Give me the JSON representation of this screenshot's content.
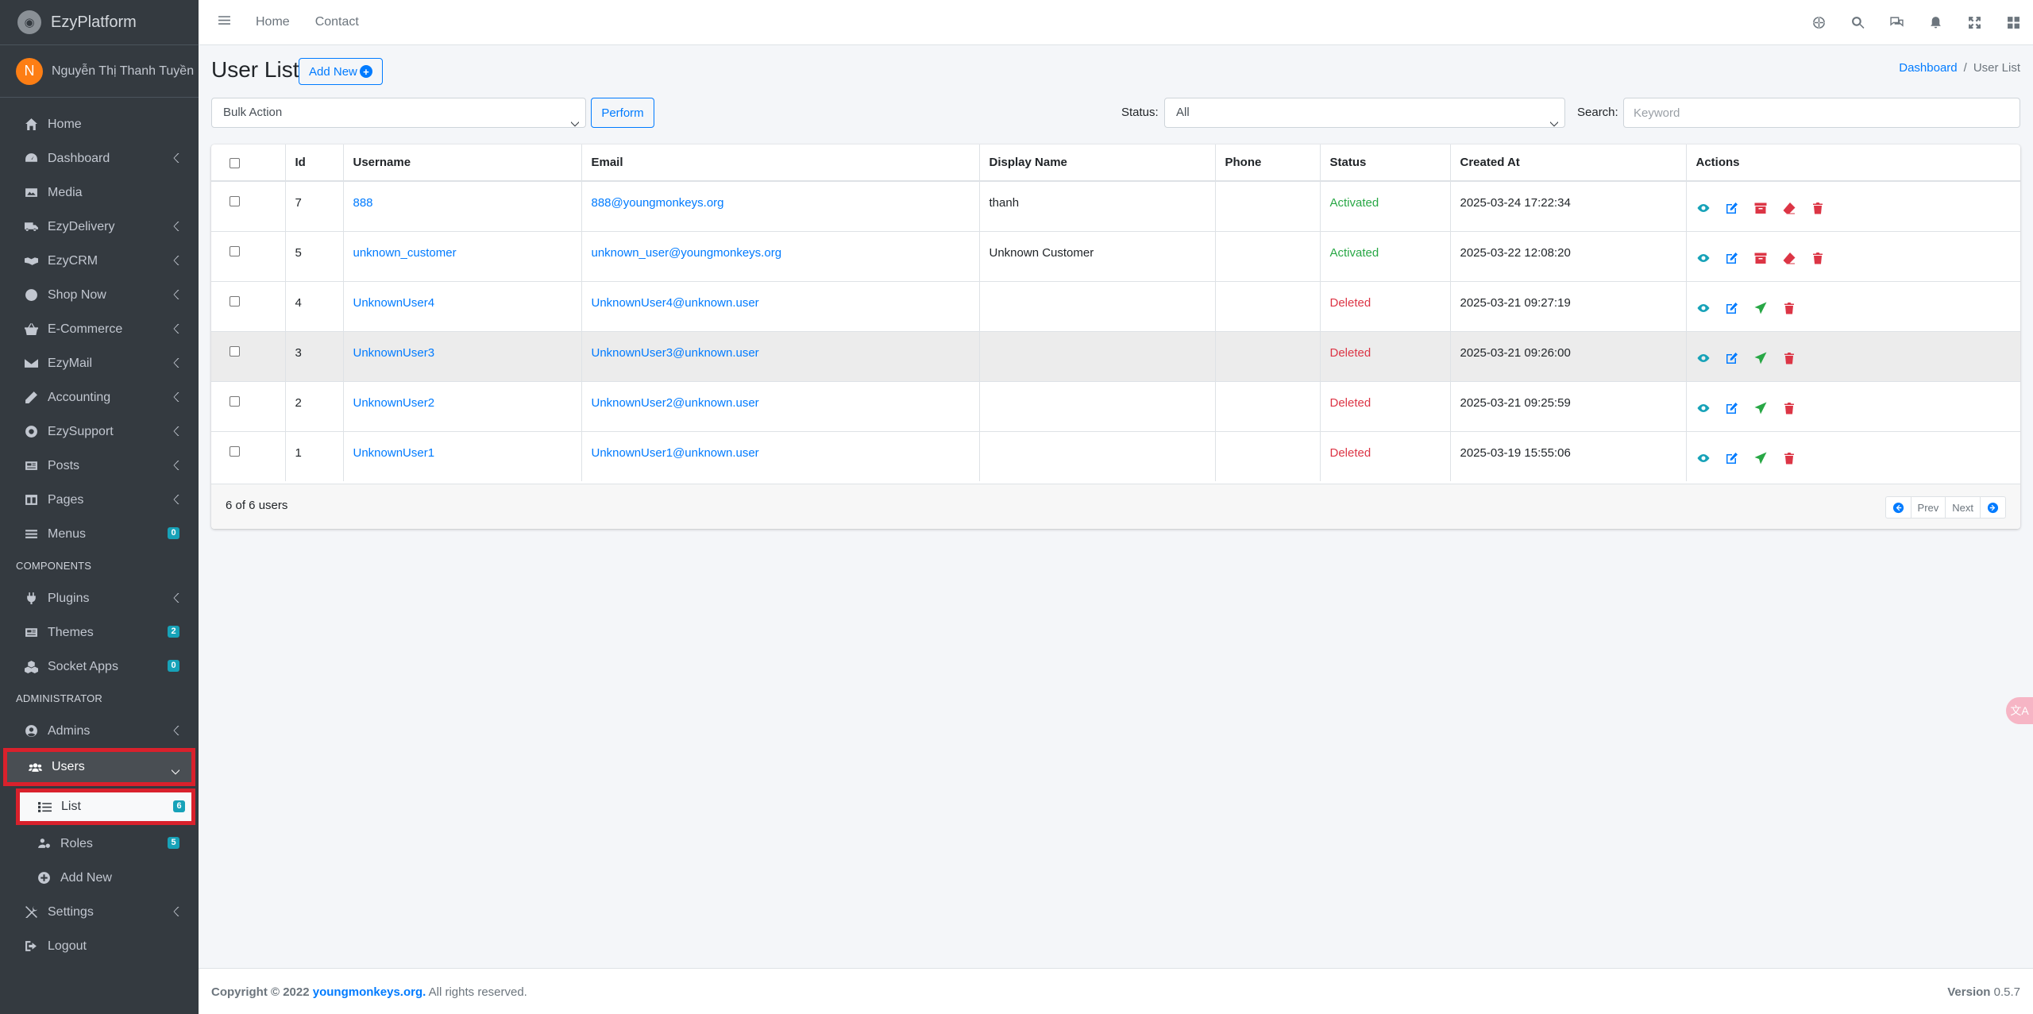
{
  "brand": {
    "name": "EzyPlatform"
  },
  "user": {
    "initial": "N",
    "name": "Nguyễn Thị Thanh Tuyền"
  },
  "sidebar": {
    "items": [
      {
        "label": "Home"
      },
      {
        "label": "Dashboard"
      },
      {
        "label": "Media"
      },
      {
        "label": "EzyDelivery"
      },
      {
        "label": "EzyCRM"
      },
      {
        "label": "Shop Now"
      },
      {
        "label": "E-Commerce"
      },
      {
        "label": "EzyMail"
      },
      {
        "label": "Accounting"
      },
      {
        "label": "EzySupport"
      },
      {
        "label": "Posts"
      },
      {
        "label": "Pages"
      },
      {
        "label": "Menus",
        "badge": "0"
      }
    ],
    "components_header": "COMPONENTS",
    "components": [
      {
        "label": "Plugins"
      },
      {
        "label": "Themes",
        "badge": "2"
      },
      {
        "label": "Socket Apps",
        "badge": "0"
      }
    ],
    "admin_header": "ADMINISTRATOR",
    "admin": [
      {
        "label": "Admins"
      },
      {
        "label": "Users"
      },
      {
        "label": "List",
        "badge": "6"
      },
      {
        "label": "Roles",
        "badge": "5"
      },
      {
        "label": "Add New"
      },
      {
        "label": "Settings"
      },
      {
        "label": "Logout"
      }
    ]
  },
  "topbar": {
    "links": [
      "Home",
      "Contact"
    ]
  },
  "page": {
    "title": "User List",
    "add_new": "Add New",
    "breadcrumb": {
      "parent": "Dashboard",
      "separator": "/",
      "current": "User List"
    }
  },
  "toolbar": {
    "bulk_action": "Bulk Action",
    "perform": "Perform",
    "status_label": "Status:",
    "status_value": "All",
    "search_label": "Search:",
    "search_placeholder": "Keyword"
  },
  "table": {
    "headers": [
      "Id",
      "Username",
      "Email",
      "Display Name",
      "Phone",
      "Status",
      "Created At",
      "Actions"
    ],
    "rows": [
      {
        "id": "7",
        "username": "888",
        "email": "888@youngmonkeys.org",
        "display_name": "thanh",
        "phone": "",
        "status": "Activated",
        "created_at": "2025-03-24 17:22:34"
      },
      {
        "id": "5",
        "username": "unknown_customer",
        "email": "unknown_user@youngmonkeys.org",
        "display_name": "Unknown Customer",
        "phone": "",
        "status": "Activated",
        "created_at": "2025-03-22 12:08:20"
      },
      {
        "id": "4",
        "username": "UnknownUser4",
        "email": "UnknownUser4@unknown.user",
        "display_name": "",
        "phone": "",
        "status": "Deleted",
        "created_at": "2025-03-21 09:27:19"
      },
      {
        "id": "3",
        "username": "UnknownUser3",
        "email": "UnknownUser3@unknown.user",
        "display_name": "",
        "phone": "",
        "status": "Deleted",
        "created_at": "2025-03-21 09:26:00"
      },
      {
        "id": "2",
        "username": "UnknownUser2",
        "email": "UnknownUser2@unknown.user",
        "display_name": "",
        "phone": "",
        "status": "Deleted",
        "created_at": "2025-03-21 09:25:59"
      },
      {
        "id": "1",
        "username": "UnknownUser1",
        "email": "UnknownUser1@unknown.user",
        "display_name": "",
        "phone": "",
        "status": "Deleted",
        "created_at": "2025-03-19 15:55:06"
      }
    ],
    "count_text": "6 of 6 users",
    "prev": "Prev",
    "next": "Next"
  },
  "footer": {
    "copyright_prefix": "Copyright © 2022",
    "site": "youngmonkeys.org.",
    "rights": "All rights reserved.",
    "version_label": "Version",
    "version": "0.5.7"
  },
  "colors": {
    "activated": "#28a745",
    "deleted": "#dc3545",
    "link": "#007bff",
    "highlight": "#d9212c"
  },
  "fab": {
    "label": "文A"
  }
}
